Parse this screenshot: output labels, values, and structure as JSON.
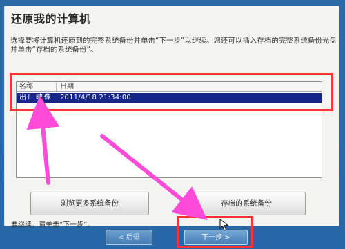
{
  "dialog": {
    "title": "还原我的计算机",
    "instructions": "选择要将计算机还原到的完整系统备份并单击“下一步”以继续。您还可以插入存档的完整系统备份光盘并单击“存档的系统备份”。"
  },
  "backup_list": {
    "headers": {
      "name": "名称",
      "date": "日期"
    },
    "rows": [
      {
        "name": "出厂映像",
        "date": "2011/4/18 21:34:00"
      }
    ]
  },
  "buttons": {
    "browse_more_label": "浏览更多系统备份",
    "archived_backup_label": "存档的系统备份",
    "back_label": "< 后退",
    "next_label": "下一步 >"
  },
  "footer": {
    "hint": "要继续，请单击“下一步”。"
  },
  "colors": {
    "selection": "#15258a",
    "annotation_box": "#ff3333",
    "annotation_arrow": "#ff4bd8"
  },
  "icons": {
    "cursor": "mouse-cursor-icon"
  }
}
